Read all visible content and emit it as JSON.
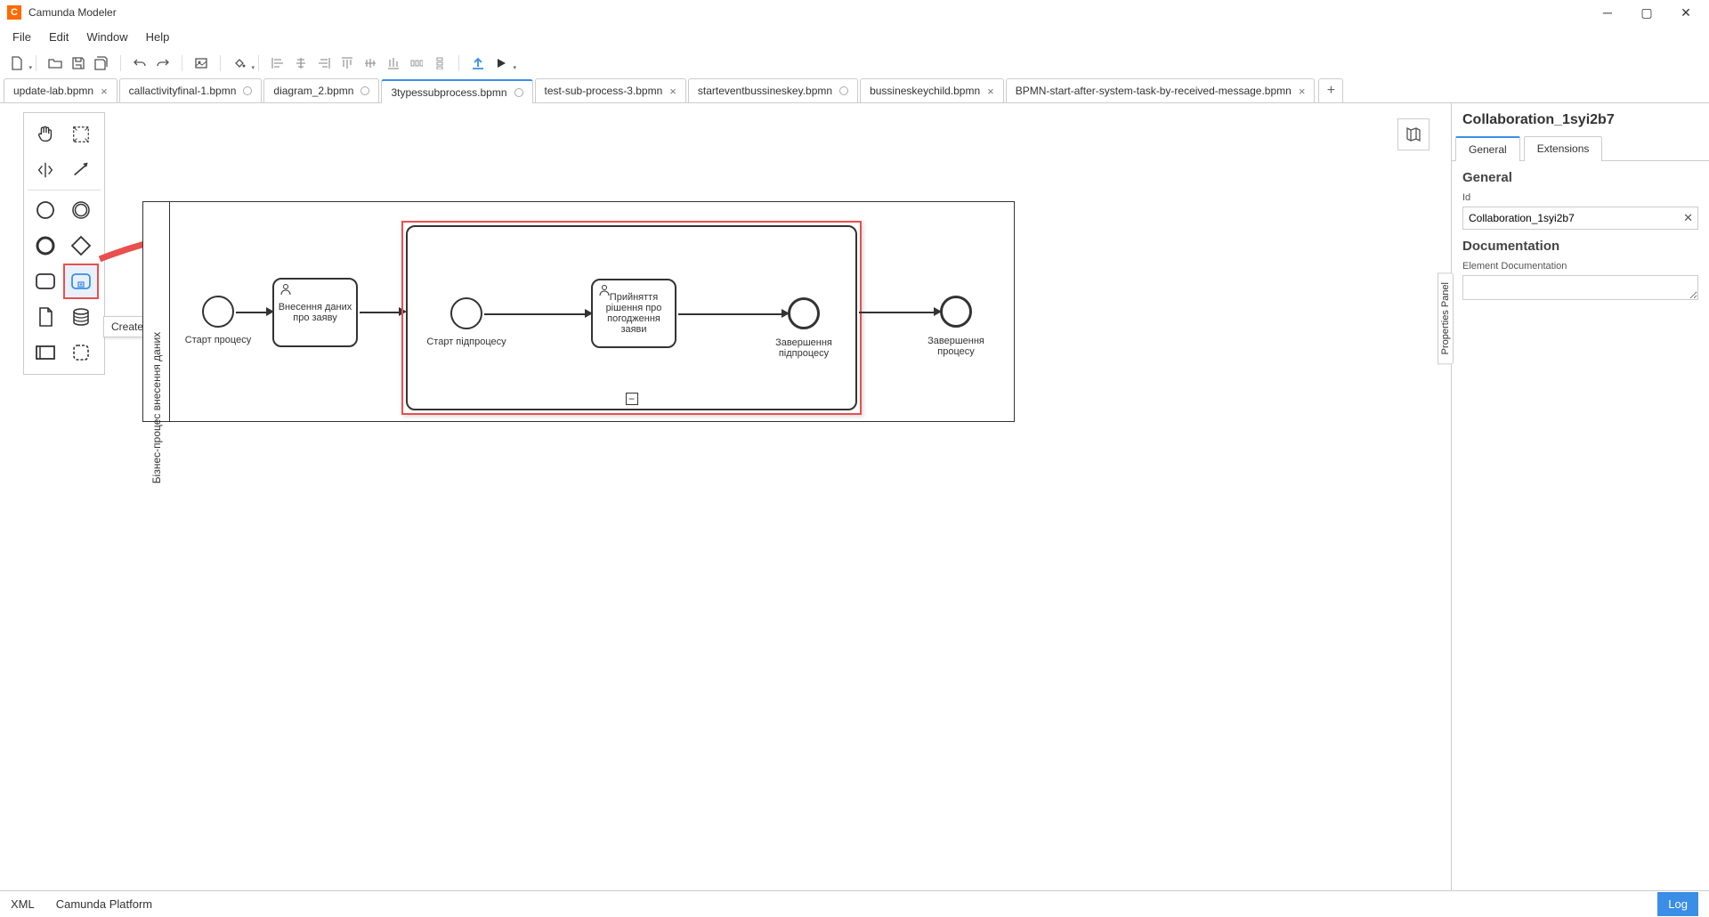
{
  "window": {
    "title": "Camunda Modeler"
  },
  "menu": {
    "items": [
      "File",
      "Edit",
      "Window",
      "Help"
    ]
  },
  "tabs": [
    {
      "label": "update-lab.bpmn",
      "closable": true
    },
    {
      "label": "callactivityfinal-1.bpmn",
      "dirty": true
    },
    {
      "label": "diagram_2.bpmn",
      "dirty": true
    },
    {
      "label": "3typessubprocess.bpmn",
      "dirty": true,
      "active": true
    },
    {
      "label": "test-sub-process-3.bpmn",
      "closable": true
    },
    {
      "label": "starteventbussineskey.bpmn",
      "dirty": true
    },
    {
      "label": "bussineskeychild.bpmn",
      "closable": true
    },
    {
      "label": "BPMN-start-after-system-task-by-received-message.bpmn",
      "closable": true
    }
  ],
  "tooltip": "Create expanded SubProcess",
  "diagram": {
    "lane": "Бізнес-процес внесення даних",
    "start_label": "Старт процесу",
    "task1": "Внесення даних про заяву",
    "sub_start_label": "Старт підпроцесу",
    "task2": "Прийняття рішення про погодження заяви",
    "sub_end_label": "Завершення підпроцесу",
    "end_label": "Завершення процесу"
  },
  "properties": {
    "header": "Collaboration_1syi2b7",
    "tabs": [
      "General",
      "Extensions"
    ],
    "section_general": "General",
    "id_label": "Id",
    "id_value": "Collaboration_1syi2b7",
    "section_doc": "Documentation",
    "doc_label": "Element Documentation",
    "doc_value": "",
    "collapse_label": "Properties Panel"
  },
  "status": {
    "left1": "XML",
    "left2": "Camunda Platform",
    "log": "Log"
  }
}
